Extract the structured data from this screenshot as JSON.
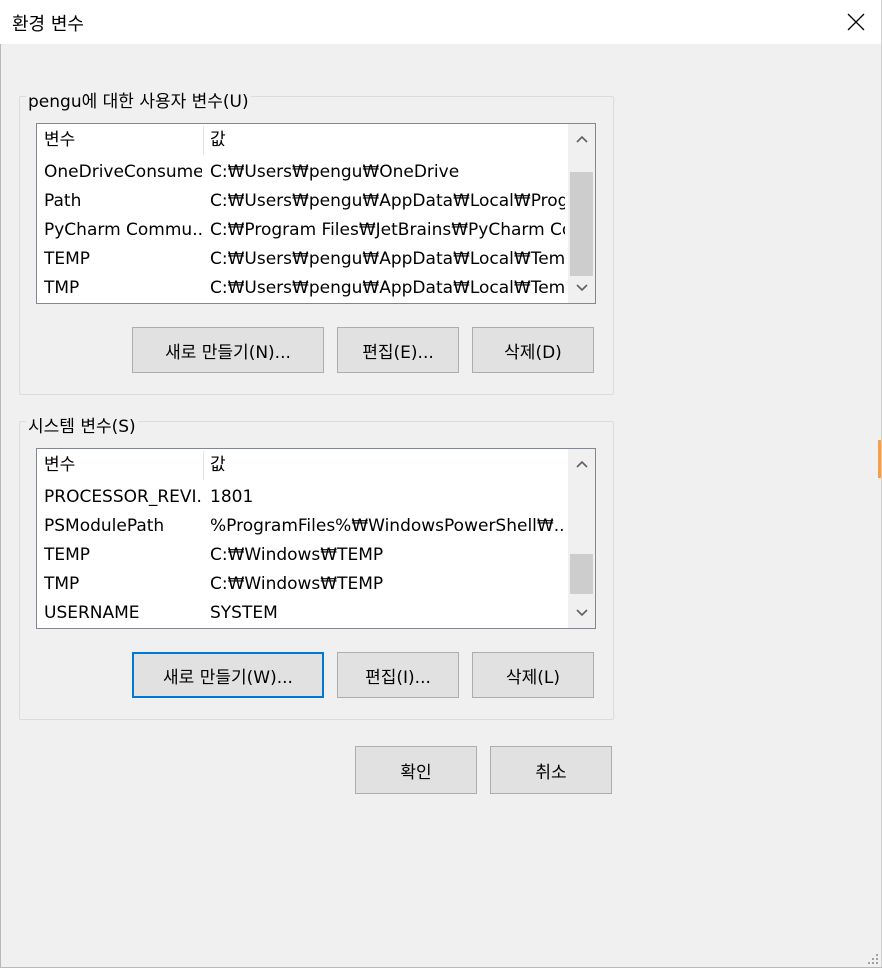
{
  "window": {
    "title": "환경 변수"
  },
  "user_vars": {
    "group_label": "pengu에 대한 사용자 변수(U)",
    "columns": [
      "변수",
      "값"
    ],
    "rows": [
      {
        "name": "OneDriveConsumer",
        "value": "C:₩Users₩pengu₩OneDrive"
      },
      {
        "name": "Path",
        "value": "C:₩Users₩pengu₩AppData₩Local₩Progr..."
      },
      {
        "name": "PyCharm Commu...",
        "value": "C:₩Program Files₩JetBrains₩PyCharm Co..."
      },
      {
        "name": "TEMP",
        "value": "C:₩Users₩pengu₩AppData₩Local₩Temp"
      },
      {
        "name": "TMP",
        "value": "C:₩Users₩pengu₩AppData₩Local₩Temp"
      }
    ],
    "buttons": {
      "new": "새로 만들기(N)...",
      "edit": "편집(E)...",
      "delete": "삭제(D)"
    }
  },
  "system_vars": {
    "group_label": "시스템 변수(S)",
    "columns": [
      "변수",
      "값"
    ],
    "rows": [
      {
        "name": "PROCESSOR_REVI...",
        "value": "1801"
      },
      {
        "name": "PSModulePath",
        "value": "%ProgramFiles%₩WindowsPowerShell₩..."
      },
      {
        "name": "TEMP",
        "value": "C:₩Windows₩TEMP"
      },
      {
        "name": "TMP",
        "value": "C:₩Windows₩TEMP"
      },
      {
        "name": "USERNAME",
        "value": "SYSTEM"
      }
    ],
    "buttons": {
      "new": "새로 만들기(W)...",
      "edit": "편집(I)...",
      "delete": "삭제(L)"
    }
  },
  "dialog_buttons": {
    "ok": "확인",
    "cancel": "취소"
  },
  "colors": {
    "accent": "#0078d7",
    "dialog_bg": "#f0f0f0",
    "button_bg": "#e1e1e1"
  }
}
